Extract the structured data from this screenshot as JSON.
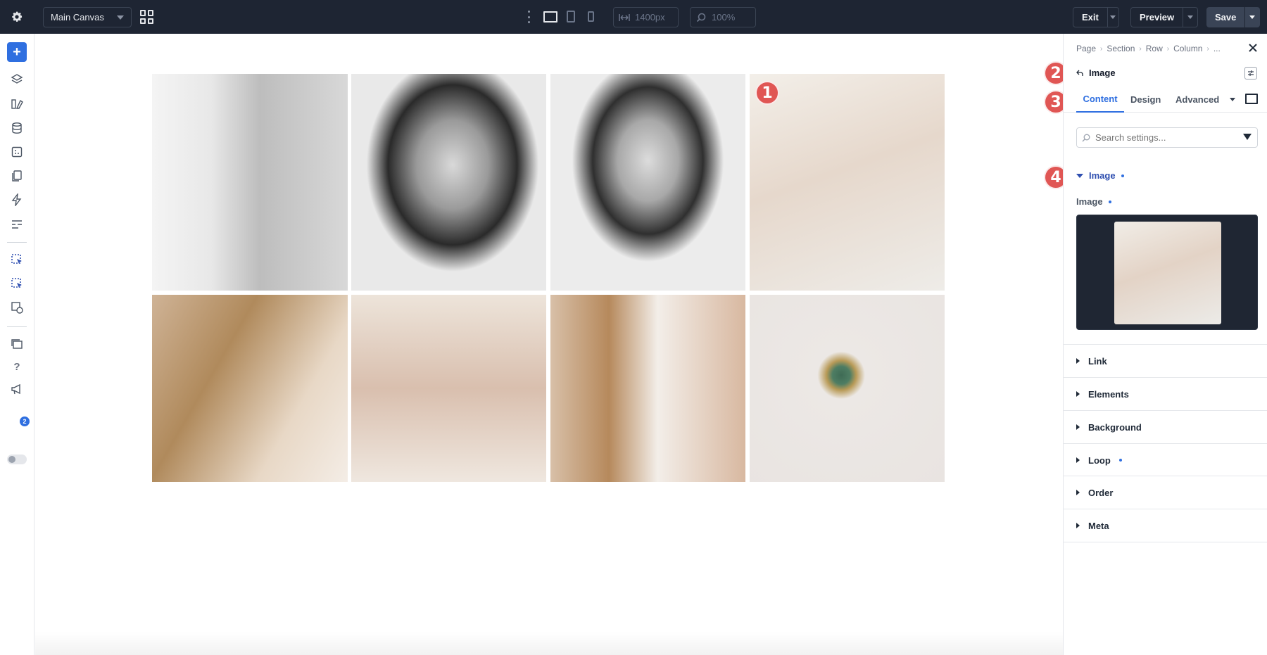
{
  "topbar": {
    "canvas_select": "Main Canvas",
    "width_value": "1400px",
    "zoom_value": "100%",
    "exit_label": "Exit",
    "preview_label": "Preview",
    "save_label": "Save"
  },
  "leftbar": {
    "notifications_badge": "2",
    "help_label": "?"
  },
  "canvas": {
    "images": [
      "Black and white portrait of woman leaning by window",
      "Black and white headshot of smiling woman",
      "Black and white headshot of man in suit",
      "Hands with gold bracelet and rings",
      "Woman with gold hoop earring",
      "Soap bars on pink blocks",
      "Woman wearing ring and necklace",
      "Gold ring with green stone"
    ]
  },
  "markers": [
    "1",
    "2",
    "3",
    "4"
  ],
  "panel": {
    "breadcrumb": [
      "Page",
      "Section",
      "Row",
      "Column",
      "..."
    ],
    "element_title": "Image",
    "tabs": [
      "Content",
      "Design",
      "Advanced"
    ],
    "search_placeholder": "Search settings...",
    "open_group": "Image",
    "field_label": "Image",
    "groups": [
      "Link",
      "Elements",
      "Background",
      "Loop",
      "Order",
      "Meta"
    ]
  },
  "colors": {
    "topbar_bg": "#1e2533",
    "accent": "#2f6fe0",
    "marker": "#e05654"
  }
}
